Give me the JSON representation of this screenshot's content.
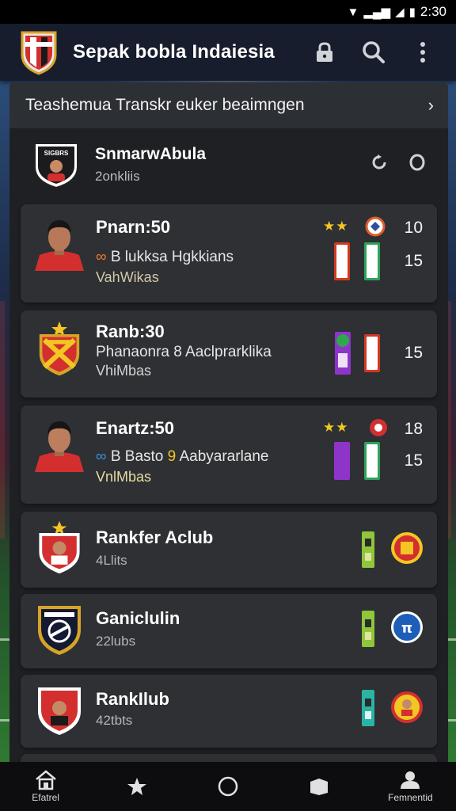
{
  "status_bar": {
    "time": "2:30"
  },
  "app_bar": {
    "title": "Sepak bobla Indaiesia",
    "actions": [
      "lock-icon",
      "search-icon",
      "more-vert-icon"
    ]
  },
  "panel": {
    "title": "Teashemua Transkr euker beaimngen",
    "header": {
      "name": "SnmarwAbula",
      "sub": "2onkliis",
      "badge_text": "SIGBRS"
    }
  },
  "players": [
    {
      "name": "Pnarn:50",
      "line2": "B lukksa Hgkkians",
      "line3": "VahWikas",
      "value_top": "10",
      "value": "15"
    },
    {
      "name": "Ranb:30",
      "line2": "Phanaonra 8 Aaclprarklika",
      "line3": "VhiMbas",
      "value": "15"
    },
    {
      "name": "Enartz:50",
      "line2_a": "B Basto",
      "line2_b": "9",
      "line2_c": "Aabyararlane",
      "line3": "VnlMbas",
      "value_top": "18",
      "value": "15"
    }
  ],
  "clubs": [
    {
      "name": "Rankfer Aclub",
      "sub": "4Llits"
    },
    {
      "name": "Ganiclulin",
      "sub": "22lubs"
    },
    {
      "name": "RankIlub",
      "sub": "42tbts"
    }
  ],
  "bottom_nav": {
    "items": [
      {
        "label": "Efatrel",
        "icon": "home-icon"
      },
      {
        "label": "",
        "icon": "transfer-icon"
      },
      {
        "label": "",
        "icon": "circle-icon"
      },
      {
        "label": "",
        "icon": "box-icon"
      },
      {
        "label": "Femnentid",
        "icon": "profile-icon"
      }
    ]
  },
  "colors": {
    "accent_red": "#d32f2f",
    "accent_gold": "#f3c623",
    "card": "#2e3034",
    "panel": "#1e2024"
  }
}
